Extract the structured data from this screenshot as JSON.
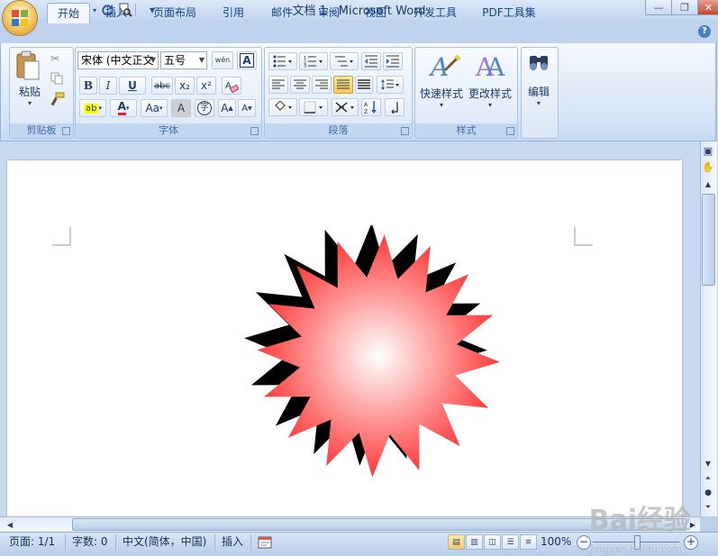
{
  "app": {
    "window_title": "文档 1 - Microsoft Word"
  },
  "window_controls": {
    "minimize": "—",
    "restore": "❐",
    "close": "✕"
  },
  "quick_access": {
    "save": "save-icon",
    "undo": "undo-icon",
    "redo": "redo-icon",
    "print_preview": "print-preview-icon",
    "customize": "▾"
  },
  "tabs": [
    {
      "label": "开始",
      "active": true
    },
    {
      "label": "插入"
    },
    {
      "label": "页面布局"
    },
    {
      "label": "引用"
    },
    {
      "label": "邮件"
    },
    {
      "label": "审阅"
    },
    {
      "label": "视图"
    },
    {
      "label": "开发工具"
    },
    {
      "label": "PDF工具集"
    }
  ],
  "help": "?",
  "ribbon": {
    "clipboard": {
      "label": "剪贴板",
      "paste": "粘贴"
    },
    "font": {
      "label": "字体",
      "font_name": "宋体 (中文正文",
      "font_size": "五号",
      "bold": "B",
      "italic": "I",
      "underline": "U",
      "strike": "abc",
      "subscript": "x₂",
      "superscript": "x²",
      "font_color": "A",
      "change_case": "Aa",
      "char_shading": "A",
      "enclose": "字",
      "grow": "A",
      "shrink": "A",
      "clear": "A",
      "phonetic": "wén"
    },
    "paragraph": {
      "label": "段落"
    },
    "styles": {
      "label": "样式",
      "quick_styles": "快速样式",
      "change_styles": "更改样式"
    },
    "editing": {
      "label": "编辑"
    }
  },
  "statusbar": {
    "page": "页面: 1/1",
    "words": "字数: 0",
    "language": "中文(简体，中国)",
    "mode": "插入",
    "zoom": "100%",
    "zoom_out": "−",
    "zoom_in": "+"
  },
  "watermark": {
    "main": "Bai经验",
    "sub": "jingyan.baidu.com"
  },
  "colors": {
    "star_outer": "#ff3a3a",
    "star_center": "#ffffff",
    "shadow": "#000000",
    "accent": "#15428b"
  }
}
